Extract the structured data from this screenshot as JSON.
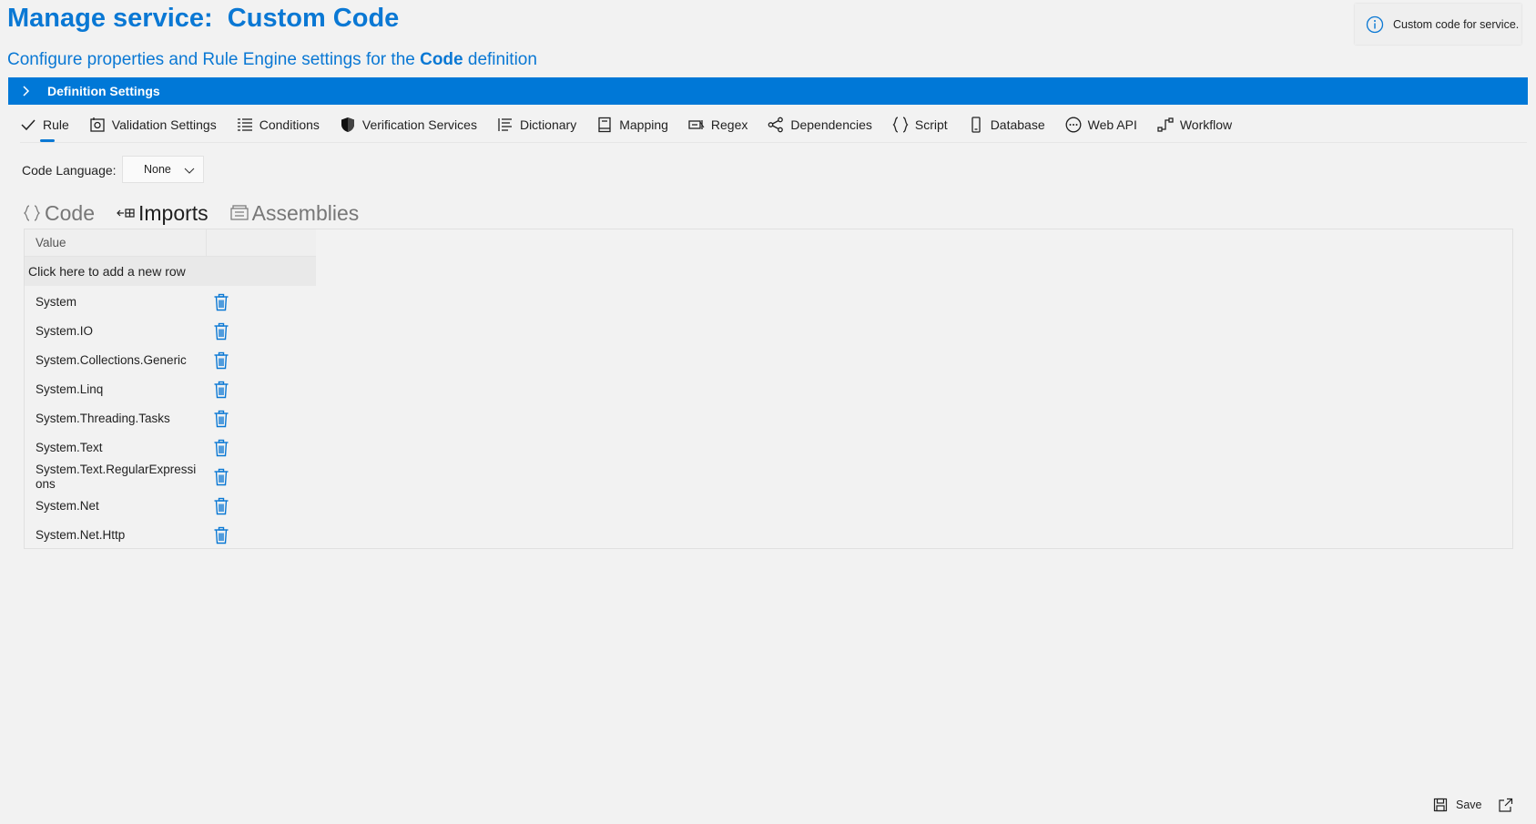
{
  "header": {
    "title": "Manage service:  Custom Code",
    "subtitle_prefix": "Configure properties and Rule Engine settings for the ",
    "subtitle_bold": "Code",
    "subtitle_suffix": " definition",
    "info_text": "Custom code for service."
  },
  "definition_bar": {
    "label": "Definition Settings"
  },
  "toolbar": [
    {
      "label": "Rule",
      "icon": "check-icon",
      "active": true
    },
    {
      "label": "Validation Settings",
      "icon": "validation-icon"
    },
    {
      "label": "Conditions",
      "icon": "list-icon"
    },
    {
      "label": "Verification Services",
      "icon": "shield-icon"
    },
    {
      "label": "Dictionary",
      "icon": "dictionary-icon"
    },
    {
      "label": "Mapping",
      "icon": "book-icon"
    },
    {
      "label": "Regex",
      "icon": "regex-icon"
    },
    {
      "label": "Dependencies",
      "icon": "share-icon"
    },
    {
      "label": "Script",
      "icon": "braces-icon"
    },
    {
      "label": "Database",
      "icon": "database-icon"
    },
    {
      "label": "Web API",
      "icon": "globe-icon"
    },
    {
      "label": "Workflow",
      "icon": "workflow-icon"
    }
  ],
  "code_language": {
    "label": "Code Language:",
    "value": "None"
  },
  "subtabs": [
    {
      "label": "Code",
      "icon": "braces-icon"
    },
    {
      "label": "Imports",
      "icon": "imports-icon",
      "active": true
    },
    {
      "label": "Assemblies",
      "icon": "assemblies-icon"
    }
  ],
  "grid": {
    "column_header": "Value",
    "add_row_text": "Click here to add a new row",
    "rows": [
      "System",
      "System.IO",
      "System.Collections.Generic",
      "System.Linq",
      "System.Threading.Tasks",
      "System.Text",
      "System.Text.RegularExpressions",
      "System.Net",
      "System.Net.Http"
    ]
  },
  "footer": {
    "save_label": "Save"
  },
  "colors": {
    "accent": "#0a78d4",
    "bar": "#0078d7",
    "background": "#f2f2f2"
  }
}
